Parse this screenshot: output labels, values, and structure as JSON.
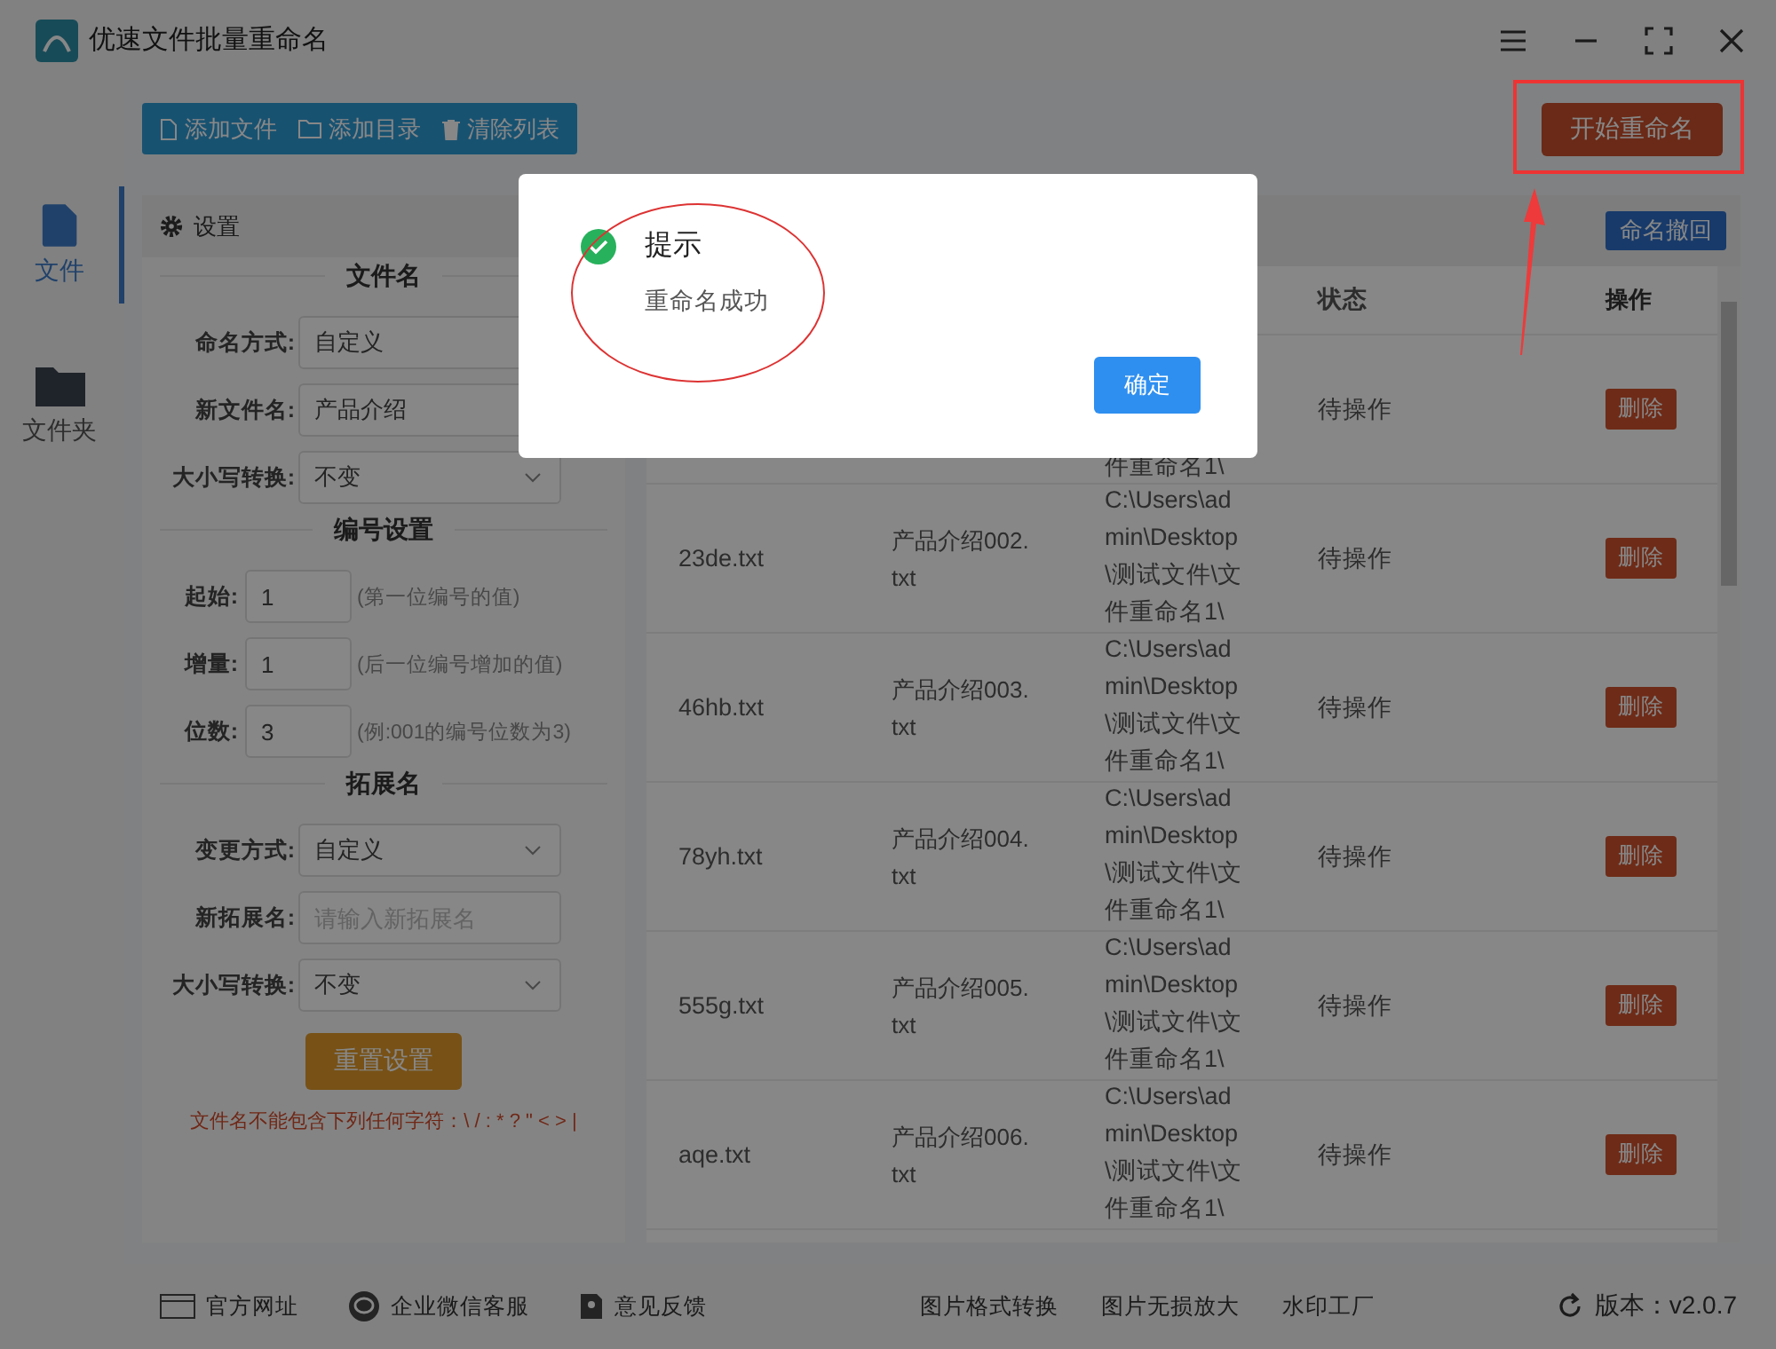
{
  "window": {
    "title": "优速文件批量重命名"
  },
  "toolbar": {
    "buttons": [
      {
        "label": "添加文件",
        "kind": "file"
      },
      {
        "label": "添加目录",
        "kind": "folder"
      },
      {
        "label": "清除列表",
        "kind": "trash"
      }
    ],
    "start_button": "开始重命名"
  },
  "sidebar": {
    "items": [
      {
        "label": "文件",
        "kind": "file",
        "selected": true
      },
      {
        "label": "文件夹",
        "kind": "folder",
        "selected": false
      }
    ]
  },
  "settings": {
    "header": "设置",
    "sections": [
      {
        "title": "文件名",
        "fields": [
          {
            "label": "命名方式:",
            "kind": "plain_select",
            "value": "自定义"
          },
          {
            "label": "新文件名:",
            "kind": "input",
            "value": "产品介绍"
          },
          {
            "label": "大小写转换:",
            "kind": "select",
            "value": "不变"
          }
        ]
      },
      {
        "title": "编号设置",
        "fields": [
          {
            "label": "起始:",
            "kind": "number",
            "value": "1",
            "hint": "(第一位编号的值)"
          },
          {
            "label": "增量:",
            "kind": "number",
            "value": "1",
            "hint": "(后一位编号增加的值)"
          },
          {
            "label": "位数:",
            "kind": "number",
            "value": "3",
            "hint": "(例:001的编号位数为3)"
          }
        ]
      },
      {
        "title": "拓展名",
        "fields": [
          {
            "label": "变更方式:",
            "kind": "select",
            "value": "自定义"
          },
          {
            "label": "新拓展名:",
            "kind": "input",
            "placeholder": "请输入新拓展名"
          },
          {
            "label": "大小写转换:",
            "kind": "select",
            "value": "不变"
          }
        ]
      }
    ],
    "reset_button": "重置设置",
    "warning": "文件名不能包含下列任何字符：\\ / : * ? \" < > |"
  },
  "table": {
    "undo_button": "命名撤回",
    "columns": [
      "状态",
      "操作"
    ],
    "rows": [
      {
        "path": "件重命名1\\",
        "status": "待操作",
        "action": "删除"
      },
      {
        "name": "23de.txt",
        "new_name": "产品介绍002.txt",
        "path": "C:\\Users\\admin\\Desktop\\测试文件\\文件重命名1\\",
        "status": "待操作",
        "action": "删除"
      },
      {
        "name": "46hb.txt",
        "new_name": "产品介绍003.txt",
        "path": "C:\\Users\\admin\\Desktop\\测试文件\\文件重命名1\\",
        "status": "待操作",
        "action": "删除"
      },
      {
        "name": "78yh.txt",
        "new_name": "产品介绍004.txt",
        "path": "C:\\Users\\admin\\Desktop\\测试文件\\文件重命名1\\",
        "status": "待操作",
        "action": "删除"
      },
      {
        "name": "555g.txt",
        "new_name": "产品介绍005.txt",
        "path": "C:\\Users\\admin\\Desktop\\测试文件\\文件重命名1\\",
        "status": "待操作",
        "action": "删除"
      },
      {
        "name": "aqe.txt",
        "new_name": "产品介绍006.txt",
        "path": "C:\\Users\\admin\\Desktop\\测试文件\\文件重命名1\\",
        "status": "待操作",
        "action": "删除"
      }
    ]
  },
  "dialog": {
    "title": "提示",
    "message": "重命名成功",
    "button": "确定"
  },
  "footer": {
    "left_links": [
      {
        "label": "官方网址",
        "kind": "web"
      },
      {
        "label": "企业微信客服",
        "kind": "chat"
      },
      {
        "label": "意见反馈",
        "kind": "feedback"
      }
    ],
    "center_links": [
      "图片格式转换",
      "图片无损放大",
      "水印工厂"
    ],
    "version": "版本：v2.0.7"
  }
}
